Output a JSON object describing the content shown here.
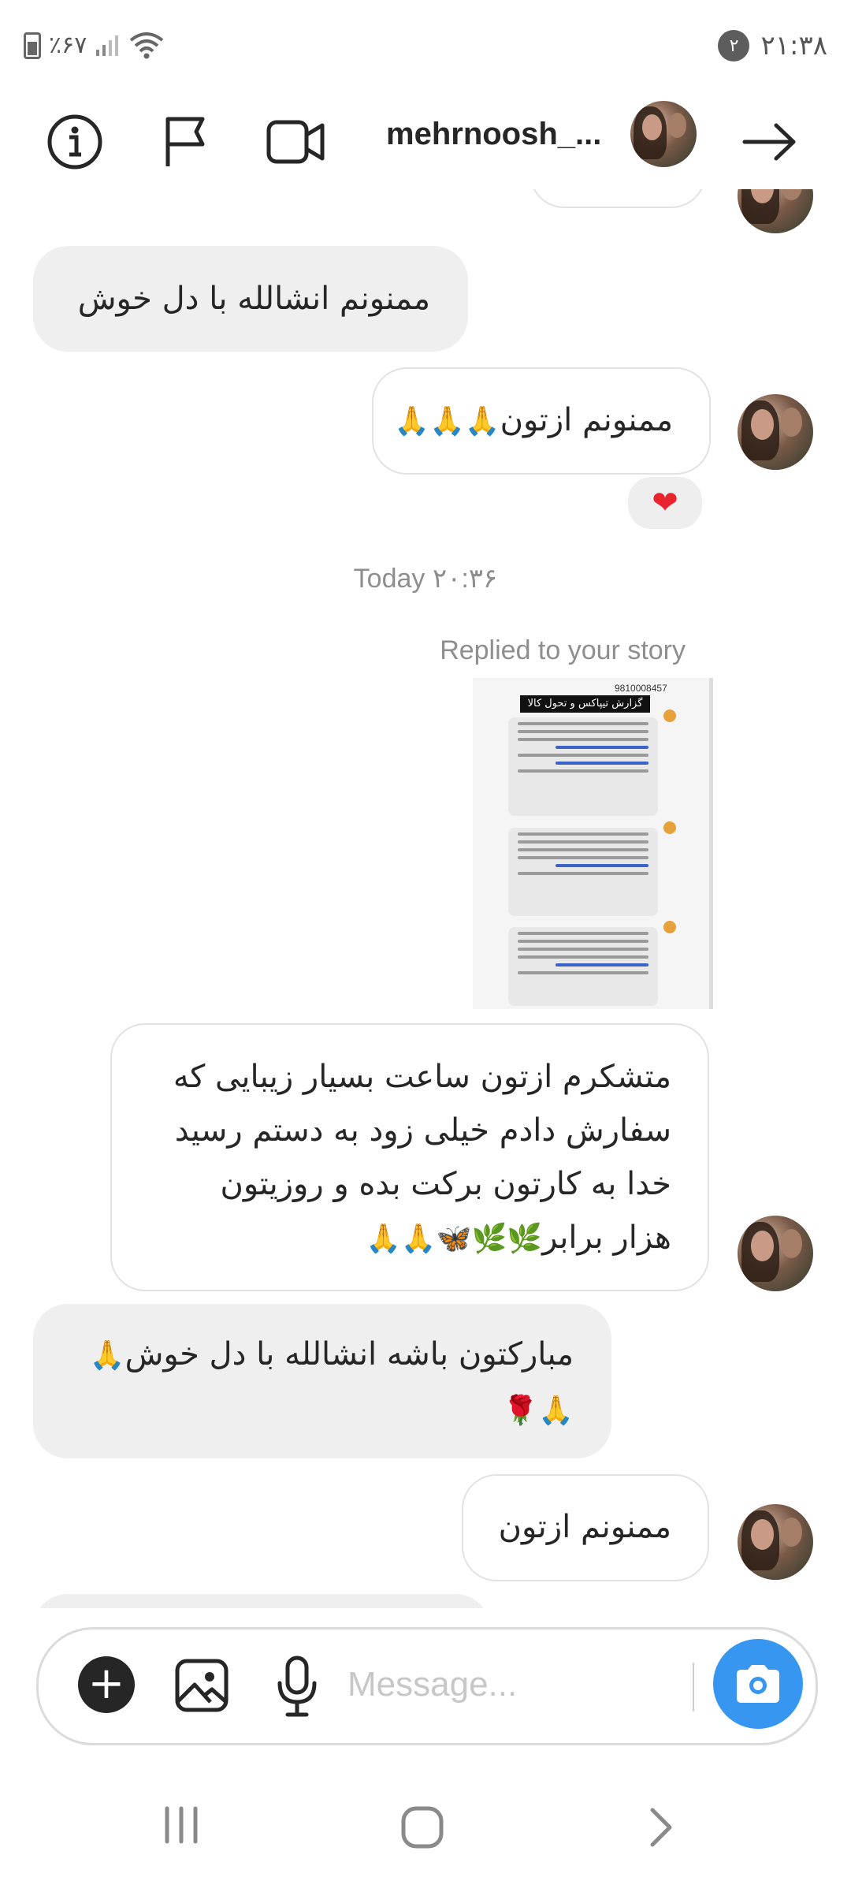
{
  "status_bar": {
    "time": "۲۱:۳۸",
    "notification_count": "۲",
    "battery": "٪۶۷"
  },
  "header": {
    "username": "mehrnoosh_..."
  },
  "messages": {
    "m1": "ممنونم انشالله با دل خوش",
    "m2": "ممنونم ازتون",
    "m2_emoji": "🙏🙏🙏",
    "reaction": "❤",
    "timestamp": "Today ۲۰:۳۶",
    "replied_label": "Replied to your story",
    "story_title": "گزارش تیپاکس و تحول کالا",
    "story_number": "9810008457",
    "m3_line1": "متشکرم ازتون ساعت بسیار زیبایی که",
    "m3_line2": "سفارش دادم خیلی زود به دستم رسید",
    "m3_line3": "خدا به کارتون برکت بده و روزیتون",
    "m3_line4": "هزار برابر",
    "m3_emoji": "🙏🙏🦋🌿🌿",
    "m4_line1": "مبارکتون باشه انشالله با دل خوش",
    "m4_emoji1": "🙏",
    "m4_emoji2": "🌹🙏",
    "m5": "ممنونم ازتون"
  },
  "composer": {
    "placeholder": "Message..."
  },
  "icons": {
    "info": "info-icon",
    "flag": "flag-icon",
    "video": "video-camera-icon",
    "forward": "arrow-right-icon",
    "add": "plus-icon",
    "gallery": "image-icon",
    "mic": "microphone-icon",
    "camera": "camera-icon"
  },
  "colors": {
    "accent": "#3797f0",
    "received_bubble": "#efefef",
    "reaction_bg": "#eeeeee",
    "heart": "#e8242e"
  }
}
